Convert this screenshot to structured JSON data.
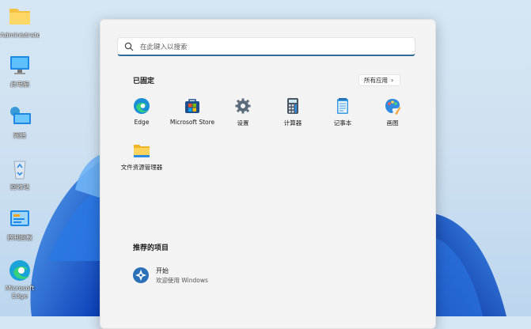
{
  "desktop": {
    "icons": [
      {
        "label": "Administrato",
        "icon": "folder-icon"
      },
      {
        "label": "此电脑",
        "icon": "computer-icon"
      },
      {
        "label": "网络",
        "icon": "network-icon"
      },
      {
        "label": "回收站",
        "icon": "recycle-bin-icon"
      },
      {
        "label": "控制面板",
        "icon": "control-panel-icon"
      },
      {
        "label": "Microsoft",
        "label2": "Edge",
        "icon": "edge-icon"
      }
    ]
  },
  "start_menu": {
    "search": {
      "placeholder": "在此键入以搜索",
      "value": ""
    },
    "pinned": {
      "title": "已固定",
      "all_apps_label": "所有应用",
      "apps": [
        {
          "label": "Edge",
          "icon": "edge-icon"
        },
        {
          "label": "Microsoft Store",
          "icon": "store-icon"
        },
        {
          "label": "设置",
          "icon": "gear-icon"
        },
        {
          "label": "计算器",
          "icon": "calculator-icon"
        },
        {
          "label": "记事本",
          "icon": "notepad-icon"
        },
        {
          "label": "画图",
          "icon": "paint-icon"
        },
        {
          "label": "文件资源管理器",
          "icon": "file-explorer-icon"
        }
      ]
    },
    "recommended": {
      "title": "推荐的项目",
      "items": [
        {
          "title": "开始",
          "subtitle": "欢迎使用 Windows",
          "icon": "get-started-icon"
        }
      ]
    }
  },
  "colors": {
    "accent": "#2c6b9e",
    "edge_blue": "#1aa3d9",
    "folder_yellow": "#f4c242",
    "wallpaper_blue": "#1f63d6"
  }
}
